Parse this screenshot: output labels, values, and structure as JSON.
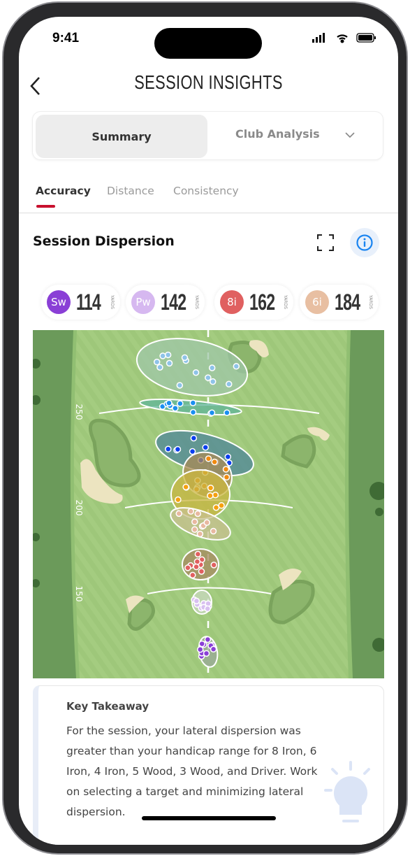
{
  "status_bar": {
    "time": "9:41"
  },
  "header": {
    "title": "SESSION INSIGHTS",
    "back_icon": "chevron-left-icon"
  },
  "segments": {
    "summary": "Summary",
    "club_analysis": "Club Analysis"
  },
  "tabs": [
    {
      "label": "Accuracy",
      "active": true
    },
    {
      "label": "Distance",
      "active": false
    },
    {
      "label": "Consistency",
      "active": false
    }
  ],
  "accent_color": "#c8102e",
  "section": {
    "title": "Session Dispersion",
    "expand_icon": "expand-icon",
    "info_icon": "info-icon"
  },
  "clubs": [
    {
      "abbr": "Sw",
      "yards": "114",
      "unit": "YARDS",
      "color": "#8a3fd6"
    },
    {
      "abbr": "Pw",
      "yards": "142",
      "unit": "YARDS",
      "color": "#d6b8f0"
    },
    {
      "abbr": "8i",
      "yards": "162",
      "unit": "YARDS",
      "color": "#e06060"
    },
    {
      "abbr": "6i",
      "yards": "184",
      "unit": "YARDS",
      "color": "#e8bfa2"
    }
  ],
  "map": {
    "yard_markers": [
      "250",
      "200",
      "150"
    ]
  },
  "takeaway": {
    "title": "Key Takeaway",
    "body": "For the session, your lateral dispersion was greater than your handicap range for 8 Iron, 6 Iron, 4 Iron, 5 Wood, 3 Wood, and Driver. Work on selecting a target and minimizing lateral dispersion.",
    "icon": "lightbulb-icon"
  }
}
